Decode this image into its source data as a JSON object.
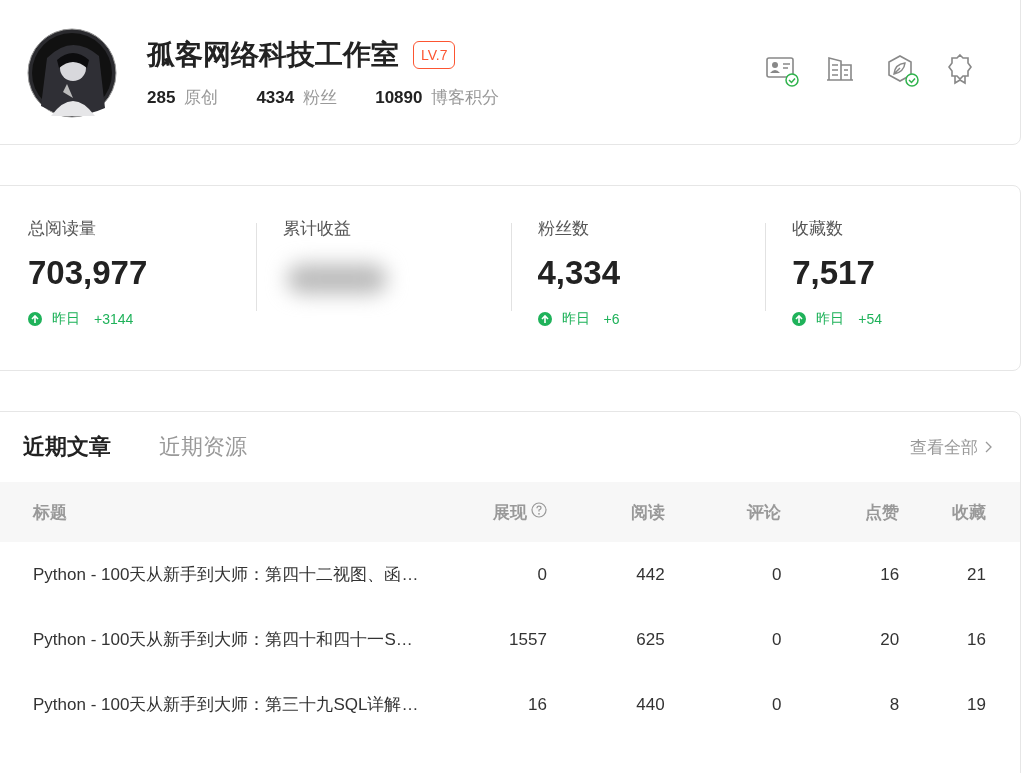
{
  "profile": {
    "name": "孤客网络科技工作室",
    "level_badge": "LV.7",
    "counts": [
      {
        "value": "285",
        "label": "原创"
      },
      {
        "value": "4334",
        "label": "粉丝"
      },
      {
        "value": "10890",
        "label": "博客积分"
      }
    ],
    "badges": [
      {
        "kind": "id-card",
        "verified": true
      },
      {
        "kind": "building",
        "verified": false
      },
      {
        "kind": "leaf",
        "verified": true
      },
      {
        "kind": "ribbon",
        "verified": false
      }
    ]
  },
  "stats": [
    {
      "label": "总阅读量",
      "kind": "value",
      "value": "703,977",
      "trend_label": "昨日",
      "trend": "+3144"
    },
    {
      "label": "累计收益",
      "kind": "blurred"
    },
    {
      "label": "粉丝数",
      "kind": "value",
      "value": "4,334",
      "trend_label": "昨日",
      "trend": "+6"
    },
    {
      "label": "收藏数",
      "kind": "value",
      "value": "7,517",
      "trend_label": "昨日",
      "trend": "+54"
    }
  ],
  "recent": {
    "tabs": [
      {
        "label": "近期文章",
        "selected": true
      },
      {
        "label": "近期资源",
        "selected": false
      }
    ],
    "view_all": "查看全部",
    "columns": [
      {
        "label": "标题",
        "help": false
      },
      {
        "label": "展现",
        "help": true
      },
      {
        "label": "阅读",
        "help": false
      },
      {
        "label": "评论",
        "help": false
      },
      {
        "label": "点赞",
        "help": false
      },
      {
        "label": "收藏",
        "help": false
      }
    ],
    "rows": [
      [
        "Python - 100天从新手到大师：第四十二视图、函…",
        "0",
        "442",
        "0",
        "16",
        "21"
      ],
      [
        "Python - 100天从新手到大师：第四十和四十一S…",
        "1557",
        "625",
        "0",
        "20",
        "16"
      ],
      [
        "Python - 100天从新手到大师：第三十九SQL详解…",
        "16",
        "440",
        "0",
        "8",
        "19"
      ]
    ]
  }
}
